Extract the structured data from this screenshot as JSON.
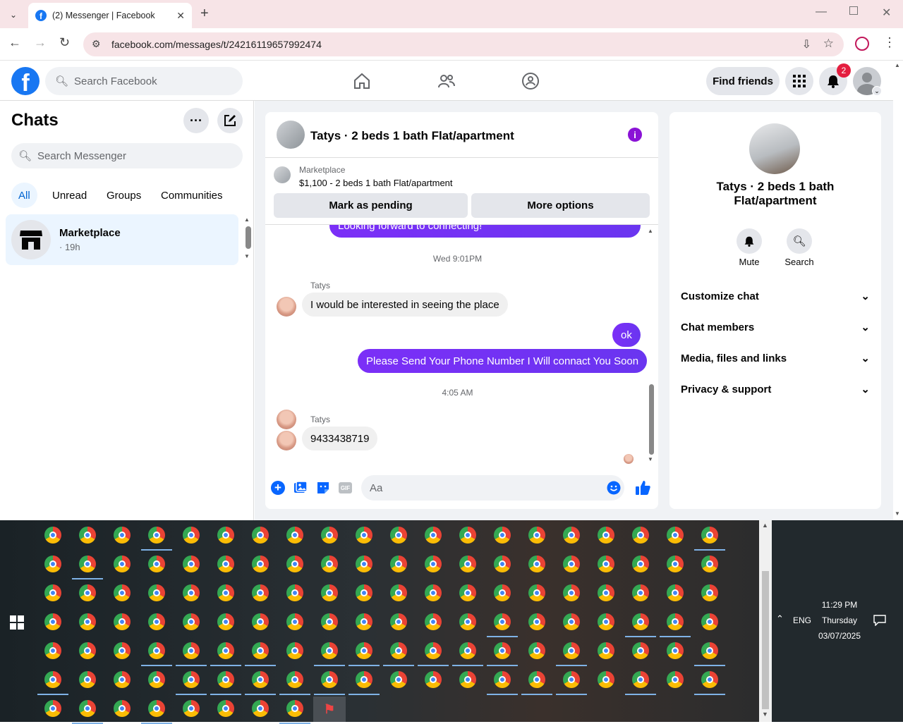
{
  "browser": {
    "tab_title": "(2) Messenger | Facebook",
    "url": "facebook.com/messages/t/24216119657992474"
  },
  "facebook": {
    "search_placeholder": "Search Facebook",
    "find_friends": "Find friends",
    "notification_count": "2"
  },
  "chats": {
    "title": "Chats",
    "search_placeholder": "Search Messenger",
    "filters": [
      "All",
      "Unread",
      "Groups",
      "Communities"
    ],
    "items": [
      {
        "name": "Marketplace",
        "time": "· 19h"
      }
    ]
  },
  "conversation": {
    "title": "Tatys · 2 beds 1 bath Flat/apartment",
    "marketplace_label": "Marketplace",
    "listing": "$1,100 - 2 beds 1 bath Flat/apartment",
    "mark_pending": "Mark as pending",
    "more_options": "More options",
    "partial_message": "Looking forward to connecting!",
    "time1": "Wed 9:01PM",
    "sender": "Tatys",
    "msg_in_1": "I would be interested in seeing the place",
    "msg_out_1": "ok",
    "msg_out_2": "Please Send Your Phone Number I Will connact You Soon",
    "time2": "4:05 AM",
    "sender2": "Tatys",
    "msg_in_2": "9433438719",
    "composer_placeholder": "Aa"
  },
  "info_panel": {
    "title": "Tatys · 2 beds 1 bath Flat/apartment",
    "mute": "Mute",
    "search": "Search",
    "sections": [
      "Customize chat",
      "Chat members",
      "Media, files and links",
      "Privacy & support"
    ]
  },
  "tray": {
    "lang": "ENG",
    "time": "11:29 PM",
    "day": "Thursday",
    "date": "03/07/2025"
  },
  "colors": {
    "accent": "#7b2ff7",
    "facebook_blue": "#1877f2",
    "notification_red": "#e41e3f"
  }
}
